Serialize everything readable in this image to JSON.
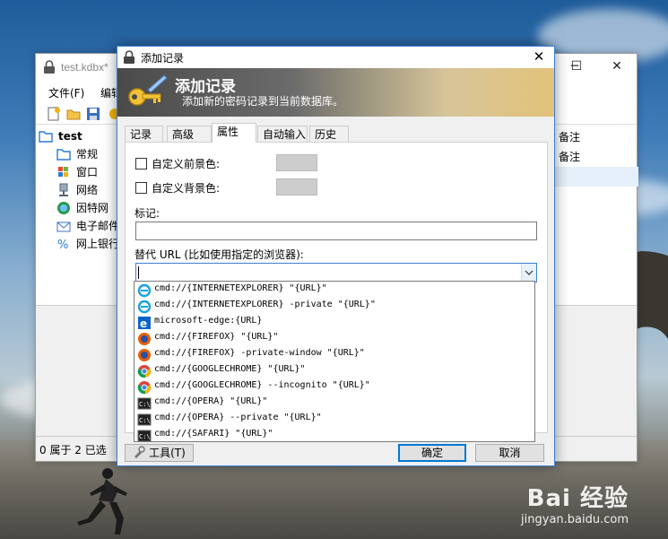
{
  "main_window": {
    "title": "test.kdbx*",
    "controls": {
      "minimize": "─",
      "maximize": "☐",
      "close": "✕"
    },
    "menu": [
      "文件(F)",
      "编辑"
    ],
    "tree": {
      "root": "test",
      "items": [
        "常规",
        "窗口",
        "网络",
        "因特网",
        "电子邮件",
        "网上银行"
      ]
    },
    "list_right": [
      "备注",
      "备注"
    ],
    "status": "0 属于 2 已选"
  },
  "dialog": {
    "title": "添加记录",
    "close": "✕",
    "banner": {
      "title": "添加记录",
      "subtitle": "添加新的密码记录到当前数据库。"
    },
    "tabs": [
      "记录",
      "高级",
      "属性",
      "自动输入",
      "历史"
    ],
    "active_tab": "属性",
    "custom_fg_label": "自定义前景色:",
    "custom_bg_label": "自定义背景色:",
    "tags_label": "标记:",
    "tags_value": "",
    "override_url_label": "替代 URL (比如使用指定的浏览器):",
    "override_url_value": "",
    "url_options": [
      {
        "icon": "ie-icon",
        "text": "cmd://{INTERNETEXPLORER} \"{URL}\""
      },
      {
        "icon": "ie-icon",
        "text": "cmd://{INTERNETEXPLORER} -private \"{URL}\""
      },
      {
        "icon": "edge-icon",
        "text": "microsoft-edge:{URL}"
      },
      {
        "icon": "firefox-icon",
        "text": "cmd://{FIREFOX} \"{URL}\""
      },
      {
        "icon": "firefox-icon",
        "text": "cmd://{FIREFOX} -private-window \"{URL}\""
      },
      {
        "icon": "chrome-icon",
        "text": "cmd://{GOOGLECHROME} \"{URL}\""
      },
      {
        "icon": "chrome-icon",
        "text": "cmd://{GOOGLECHROME} --incognito \"{URL}\""
      },
      {
        "icon": "terminal-icon",
        "text": "cmd://{OPERA} \"{URL}\""
      },
      {
        "icon": "terminal-icon",
        "text": "cmd://{OPERA} --private \"{URL}\""
      },
      {
        "icon": "terminal-icon",
        "text": "cmd://{SAFARI} \"{URL}\""
      }
    ],
    "tools_button": "工具(T)",
    "ok_button": "确定",
    "cancel_button": "取消"
  },
  "watermark": {
    "logo": "Bai 经验",
    "url": "jingyan.baidu.com"
  }
}
